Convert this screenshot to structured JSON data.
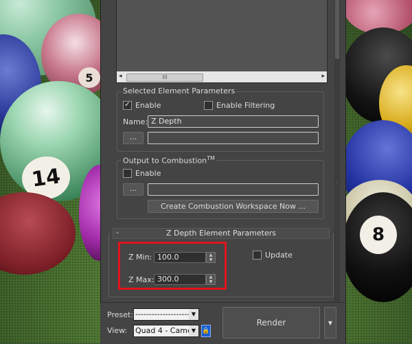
{
  "background": {
    "balls": [
      {
        "number": "14"
      },
      {
        "number": "5"
      },
      {
        "number": "8"
      }
    ]
  },
  "selected_element_parameters": {
    "legend": "Selected Element Parameters",
    "enable_label": "Enable",
    "enable_checked": true,
    "enable_filtering_label": "Enable Filtering",
    "enable_filtering_checked": false,
    "name_label": "Name:",
    "name_value": "Z Depth",
    "browse_label": "...",
    "path_value": ""
  },
  "output_to_combustion": {
    "legend": "Output to Combustion",
    "legend_sup": "TM",
    "enable_label": "Enable",
    "enable_checked": false,
    "browse_label": "...",
    "path_value": "",
    "create_workspace_label": "Create Combustion Workspace Now ..."
  },
  "z_depth_params": {
    "minus": "-",
    "title": "Z Depth Element Parameters",
    "z_min_label": "Z Min:",
    "z_min_value": "100.0",
    "z_max_label": "Z Max:",
    "z_max_value": "300.0",
    "update_label": "Update",
    "update_checked": false
  },
  "list_scroll": {
    "left_arrow": "◂",
    "right_arrow": "▸",
    "thumb_grip": "III"
  },
  "footer": {
    "preset_label": "Preset:",
    "preset_value": "--------------------",
    "view_label": "View:",
    "view_value": "Quad 4 - Camer",
    "render_label": "Render"
  },
  "colors": {
    "highlight": "#e0141b",
    "lock_button": "#1a5fd1"
  }
}
